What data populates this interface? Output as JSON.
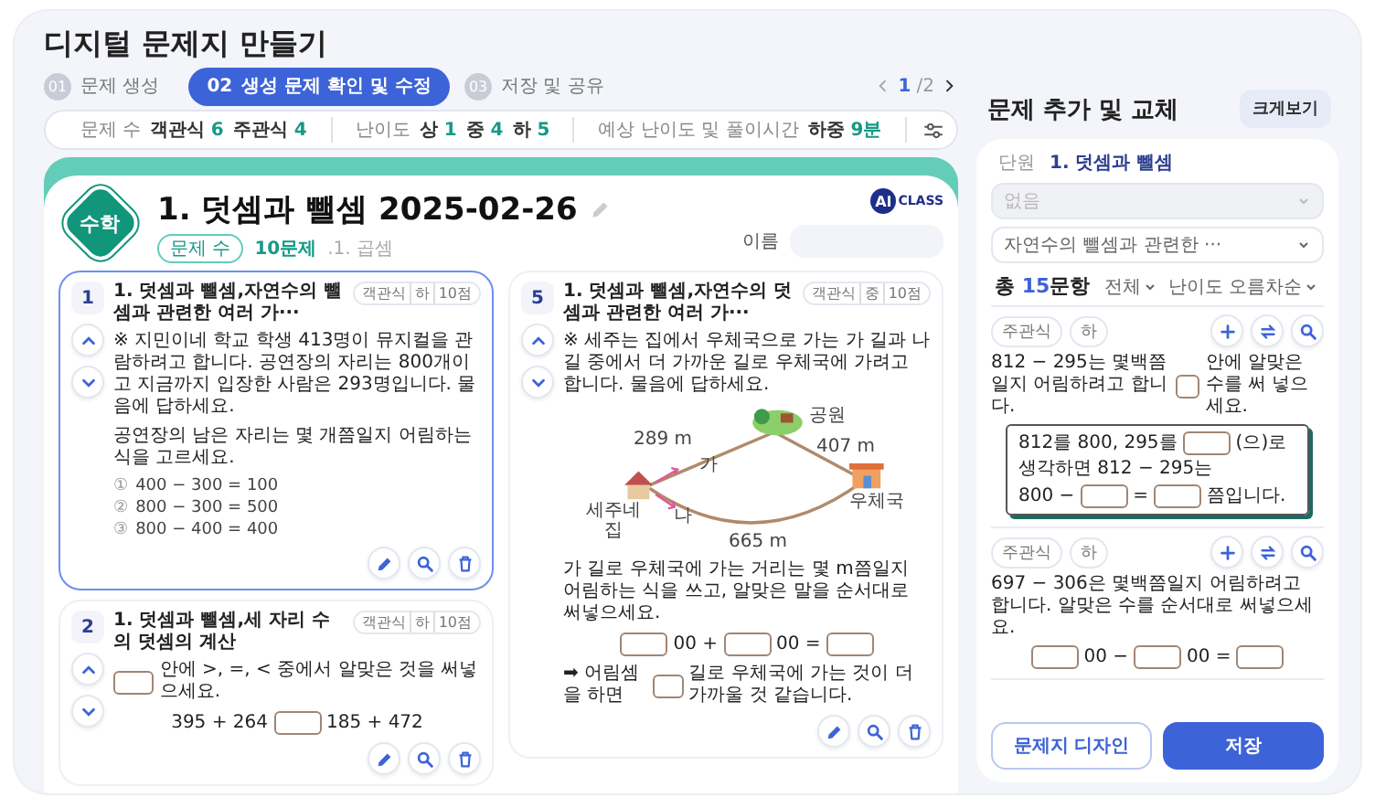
{
  "page_title": "디지털 문제지 만들기",
  "steps": [
    {
      "number": "01",
      "label": "문제 생성",
      "selected": false
    },
    {
      "number": "02",
      "label": "생성 문제 확인 및 수정",
      "selected": true
    },
    {
      "number": "03",
      "label": "저장 및 공유",
      "selected": false
    }
  ],
  "pager": {
    "current": "1",
    "total": "/2"
  },
  "summary": [
    {
      "label": "문제 수",
      "values": [
        {
          "label": "객관식",
          "count": "6"
        },
        {
          "label": "주관식",
          "count": "4"
        }
      ]
    },
    {
      "label": "난이도",
      "values": [
        {
          "label": "상",
          "count": "1"
        },
        {
          "label": "중",
          "count": "4"
        },
        {
          "label": "하",
          "count": "5"
        }
      ]
    },
    {
      "label": "예상 난이도 및 풀이시간",
      "values": [
        {
          "label": "하중",
          "count": "9분"
        }
      ]
    }
  ],
  "sheet": {
    "subject": "수학",
    "title": "1. 덧셈과 뺄셈 2025-02-26",
    "count_label": "문제 수",
    "count": "10문제",
    "unit": ".1. 곱셈",
    "logo_mark": "AI",
    "logo_text": "CLASS",
    "name_label": "이름",
    "columns": [
      {
        "questions": [
          {
            "number": "1",
            "title": "1. 덧셈과 뺄셈,자연수의 뺄셈과 관련한 여러 가···",
            "type": "객관식",
            "level": "하",
            "points": "10점",
            "selected": true,
            "blocks": [
              {
                "kind": "text",
                "text": "※ 지민이네 학교 학생 413명이 뮤지컬을 관람하려고 합니다. 공연장의 자리는 800개이고 지금까지 입장한 사람은 293명입니다. 물음에 답하세요."
              },
              {
                "kind": "text",
                "text": "공연장의 남은 자리는 몇 개쯤일지 어림하는 식을 고르세요."
              },
              {
                "kind": "choices",
                "items": [
                  {
                    "mark": "①",
                    "text": "400 − 300 = 100"
                  },
                  {
                    "mark": "②",
                    "text": "800 − 300 = 500"
                  },
                  {
                    "mark": "③",
                    "text": "800 − 400 = 400"
                  }
                ]
              }
            ]
          },
          {
            "number": "2",
            "title": "1. 덧셈과 뺄셈,세 자리 수의 덧셈의 계산",
            "type": "객관식",
            "level": "하",
            "points": "10점",
            "selected": false,
            "blocks": [
              {
                "kind": "line",
                "parts": [
                  {
                    "kind": "blank"
                  },
                  {
                    "kind": "word",
                    "text": "안에 >, =, < 중에서 알맞은 것을 써넣으세요."
                  }
                ]
              },
              {
                "kind": "equation",
                "parts": [
                  {
                    "kind": "word",
                    "text": "395 + 264"
                  },
                  {
                    "kind": "blank"
                  },
                  {
                    "kind": "word",
                    "text": "185 + 472"
                  }
                ]
              }
            ]
          }
        ]
      },
      {
        "questions": [
          {
            "number": "5",
            "title": "1. 덧셈과 뺄셈,자연수의 덧셈과 관련한 여러 가···",
            "type": "객관식",
            "level": "중",
            "points": "10점",
            "selected": false,
            "blocks": [
              {
                "kind": "text",
                "text": "※ 세주는 집에서 우체국으로 가는 가 길과 나 길 중에서 더 가까운 길로 우체국에 가려고 합니다. 물음에 답하세요."
              },
              {
                "kind": "diagram",
                "labels": [
                  "공원",
                  "289 m",
                  "407 m",
                  "가",
                  "세주네 집",
                  "나",
                  "우체국",
                  "665 m"
                ]
              },
              {
                "kind": "text",
                "text": "가 길로 우체국에 가는 거리는 몇 m쯤일지 어림하는 식을 쓰고, 알맞은 말을 순서대로 써넣으세요."
              },
              {
                "kind": "equation",
                "parts": [
                  {
                    "kind": "blank"
                  },
                  {
                    "kind": "word",
                    "text": "00 +"
                  },
                  {
                    "kind": "blank"
                  },
                  {
                    "kind": "word",
                    "text": "00 ="
                  },
                  {
                    "kind": "blank"
                  }
                ]
              },
              {
                "kind": "line",
                "parts": [
                  {
                    "kind": "word",
                    "text": "➡ 어림셈을 하면"
                  },
                  {
                    "kind": "blank"
                  },
                  {
                    "kind": "word",
                    "text": "길로 우체국에 가는 것이 더 가까울 것 같습니다."
                  }
                ]
              }
            ]
          }
        ]
      }
    ]
  },
  "bank": {
    "title": "문제 추가 및 교체",
    "expand_button": "크게보기",
    "unit_label": "단원",
    "unit": "1. 덧셈과 뺄셈",
    "filters": [
      {
        "value": "없음",
        "disabled": true
      },
      {
        "value": "자연수의 뺄셈과 관련한 ···",
        "disabled": false
      }
    ],
    "total_prefix": "총",
    "total": "15",
    "total_suffix": "문항",
    "sorts": [
      "전체",
      "난이도 오름차순"
    ],
    "items": [
      {
        "type": "주관식",
        "level": "하",
        "blocks": [
          {
            "kind": "line",
            "parts": [
              {
                "kind": "word",
                "text": "812 − 295는 몇백쯤일지 어림하려고 합니다."
              },
              {
                "kind": "blank"
              },
              {
                "kind": "word",
                "text": "안에 알맞은 수를 써 넣으세요."
              }
            ]
          },
          {
            "kind": "hint",
            "lines": [
              [
                {
                  "kind": "word",
                  "text": "812를 800, 295를"
                },
                {
                  "kind": "blank"
                },
                {
                  "kind": "word",
                  "text": "(으)로"
                }
              ],
              [
                {
                  "kind": "word",
                  "text": "생각하면 812 − 295는"
                }
              ],
              [
                {
                  "kind": "word",
                  "text": "800 −"
                },
                {
                  "kind": "blank"
                },
                {
                  "kind": "word",
                  "text": "="
                },
                {
                  "kind": "blank"
                },
                {
                  "kind": "word",
                  "text": "쯤입니다."
                }
              ]
            ]
          }
        ]
      },
      {
        "type": "주관식",
        "level": "하",
        "blocks": [
          {
            "kind": "text",
            "text": "697 − 306은 몇백쯤일지 어림하려고 합니다. 알맞은 수를 순서대로 써넣으세요."
          },
          {
            "kind": "equation",
            "parts": [
              {
                "kind": "blank"
              },
              {
                "kind": "word",
                "text": "00 −"
              },
              {
                "kind": "blank"
              },
              {
                "kind": "word",
                "text": "00 ="
              },
              {
                "kind": "blank"
              }
            ]
          }
        ]
      }
    ],
    "buttons": [
      {
        "label": "문제지 디자인",
        "kind": "secondary"
      },
      {
        "label": "저장",
        "kind": "primary"
      }
    ]
  }
}
